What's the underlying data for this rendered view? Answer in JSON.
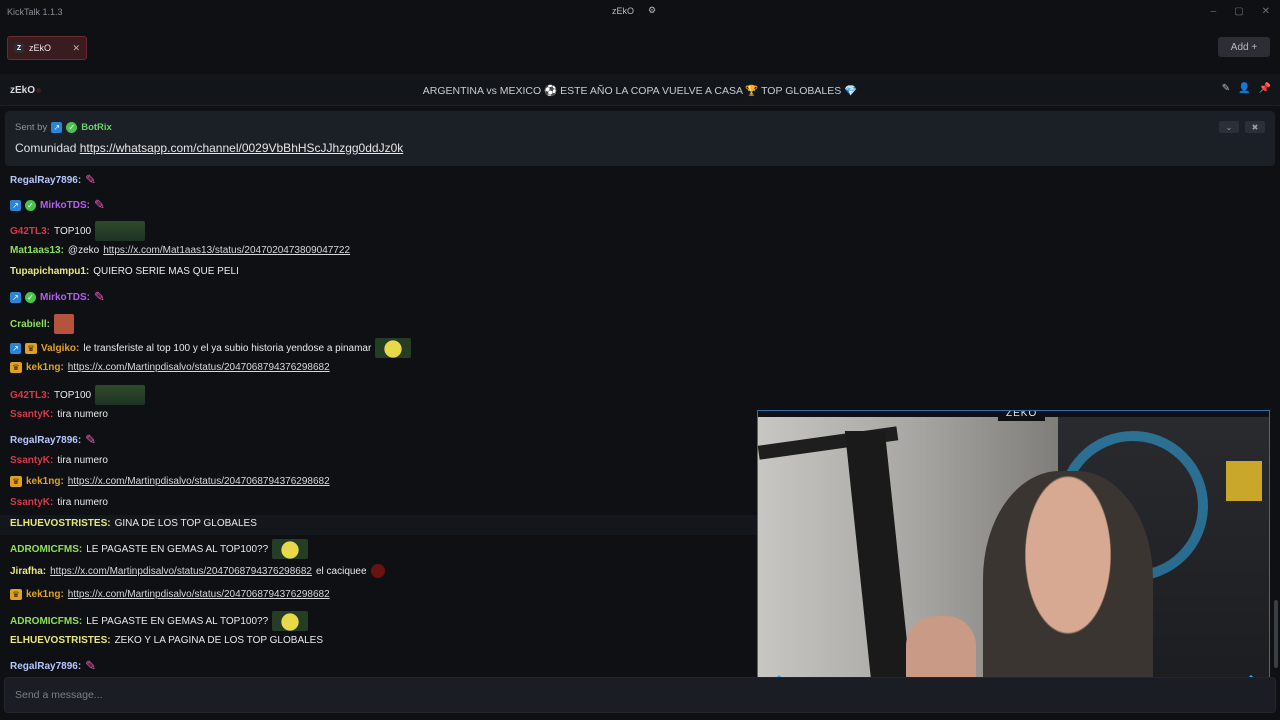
{
  "app": {
    "title": "KickTalk 1.1.3",
    "center_label": "zEkO"
  },
  "tabs": [
    {
      "label": "zEkO"
    }
  ],
  "add_button": {
    "label": "Add +"
  },
  "channel": {
    "name": "zEkO",
    "stream_title": "ARGENTINA vs MEXICO ⚽ ESTE AÑO LA COPA VUELVE A CASA 🏆 TOP GLOBALES 💎"
  },
  "pinned": {
    "sent_by_label": "Sent by",
    "bot_name": "BotRix",
    "text": "Comunidad",
    "link": "https://whatsapp.com/channel/0029VbBhHScJJhzgg0ddJz0k"
  },
  "messages": [
    {
      "user": "RegalRay7896:",
      "color": "#b7c7ff",
      "text": "",
      "emote": "pink"
    },
    {
      "user": "MirkoTDS:",
      "color": "#b65cf2",
      "text": "",
      "emote": "pink",
      "badges": [
        "kick",
        "verified"
      ]
    },
    {
      "user": "G42TL3:",
      "color": "#d43a4a",
      "text": "TOP100",
      "emote": "car"
    },
    {
      "user": "Mat1aas13:",
      "color": "#8fe05a",
      "text": "@zeko",
      "link": "https://x.com/Mat1aas13/status/2047020473809047722"
    },
    {
      "user": "Tupapichampu1:",
      "color": "#e8e87a",
      "text": "QUIERO SERIE MAS QUE PELI"
    },
    {
      "user": "MirkoTDS:",
      "color": "#b65cf2",
      "text": "",
      "emote": "pink",
      "badges": [
        "kick",
        "verified"
      ]
    },
    {
      "user": "Crabiell:",
      "color": "#8fe05a",
      "text": "",
      "emote": "face"
    },
    {
      "user": "Valgiko:",
      "color": "#e0a21e",
      "text": "le transferiste al top 100 y el ya subio historia yendose a pinamar",
      "emote": "yellow",
      "badges": [
        "kick",
        "crown"
      ]
    },
    {
      "user": "kek1ng:",
      "color": "#e0a21e",
      "link": "https://x.com/Martinpdisalvo/status/2047068794376298682",
      "badges": [
        "crown"
      ]
    },
    {
      "user": "G42TL3:",
      "color": "#d43a4a",
      "text": "TOP100",
      "emote": "car"
    },
    {
      "user": "SsantyK:",
      "color": "#d43a4a",
      "text": "tira numero"
    },
    {
      "user": "RegalRay7896:",
      "color": "#b7c7ff",
      "text": "",
      "emote": "pink"
    },
    {
      "user": "SsantyK:",
      "color": "#d43a4a",
      "text": "tira numero"
    },
    {
      "user": "kek1ng:",
      "color": "#e0a21e",
      "link": "https://x.com/Martinpdisalvo/status/2047068794376298682",
      "badges": [
        "crown"
      ]
    },
    {
      "user": "SsantyK:",
      "color": "#d43a4a",
      "text": "tira numero"
    },
    {
      "user": "ELHUEVOSTRISTES:",
      "color": "#e8e87a",
      "text": "GINA DE LOS TOP GLOBALES"
    },
    {
      "user": "ADROMICFMS:",
      "color": "#8fe05a",
      "text": "LE PAGASTE EN GEMAS AL TOP100??",
      "emote": "yellow"
    },
    {
      "user": "Jirafha:",
      "color": "#e8e87a",
      "link": "https://x.com/Martinpdisalvo/status/2047068794376298682",
      "text_after": "el caciquee",
      "emote": "red"
    },
    {
      "user": "kek1ng:",
      "color": "#e0a21e",
      "link": "https://x.com/Martinpdisalvo/status/2047068794376298682",
      "badges": [
        "crown"
      ]
    },
    {
      "user": "ADROMICFMS:",
      "color": "#8fe05a",
      "text": "LE PAGASTE EN GEMAS AL TOP100??",
      "emote": "yellow"
    },
    {
      "user": "ELHUEVOSTRISTES:",
      "color": "#e8e87a",
      "text": "ZEKO Y LA PAGINA DE LOS TOP GLOBALES"
    },
    {
      "user": "RegalRay7896:",
      "color": "#b7c7ff",
      "text": "",
      "emote": "pink"
    }
  ],
  "input": {
    "placeholder": "Send a message..."
  },
  "webcam": {
    "overlay_label": "ZEKO",
    "logo": "Z"
  },
  "colors": {
    "accent": "#2fa9e6",
    "tab_bg": "#3a1b1f",
    "bot_green": "#66d46b"
  }
}
